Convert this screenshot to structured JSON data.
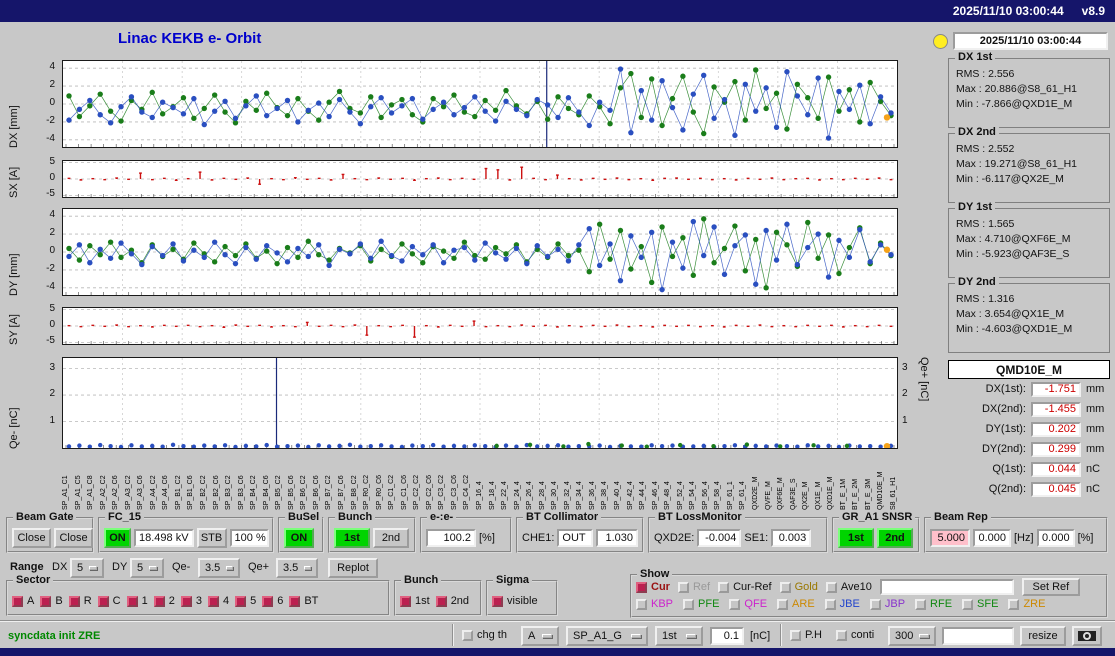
{
  "titlebar": {
    "datetime": "2025/11/10 03:00:44",
    "version": "v8.9"
  },
  "header": {
    "title": "Linac KEKB e- Orbit",
    "timestamp": "2025/11/10 03:00:44"
  },
  "colors": {
    "titlebar": "#15156a",
    "title_blue": "#0000cc",
    "button_green": "#00d400",
    "alert_pink": "#ffc0cb",
    "value_red": "#cc0000",
    "marker_amber": "#f5a31a",
    "series_blue": "#2a4fc0",
    "series_green": "#1a7d1a",
    "series_red": "#cc1111",
    "checkbox_red": "#bb2050",
    "status_green": "#008800"
  },
  "stats": [
    {
      "title": "DX 1st",
      "rms": "RMS : 2.556",
      "max": "Max : 20.886@S8_61_H1",
      "min": "Min : -7.866@QXD1E_M"
    },
    {
      "title": "DX 2nd",
      "rms": "RMS : 2.552",
      "max": "Max : 19.271@S8_61_H1",
      "min": "Min : -6.117@QX2E_M"
    },
    {
      "title": "DY 1st",
      "rms": "RMS : 1.565",
      "max": "Max : 4.710@QXF6E_M",
      "min": "Min : -5.923@QAF3E_S"
    },
    {
      "title": "DY 2nd",
      "rms": "RMS : 1.316",
      "max": "Max : 3.654@QX1E_M",
      "min": "Min : -4.603@QXD1E_M"
    }
  ],
  "monitor": {
    "title": "QMD10E_M",
    "rows": [
      {
        "label": "DX(1st):",
        "value": "-1.751",
        "unit": "mm"
      },
      {
        "label": "DX(2nd):",
        "value": "-1.455",
        "unit": "mm"
      },
      {
        "label": "DY(1st):",
        "value": "0.202",
        "unit": "mm"
      },
      {
        "label": "DY(2nd):",
        "value": "0.299",
        "unit": "mm"
      },
      {
        "label": "Q(1st):",
        "value": "0.044",
        "unit": "nC"
      },
      {
        "label": "Q(2nd):",
        "value": "0.045",
        "unit": "nC"
      }
    ]
  },
  "controls": {
    "beam_gate": {
      "label": "Beam Gate",
      "btn1": "Close",
      "btn2": "Close"
    },
    "fc15": {
      "label": "FC_15",
      "on": "ON",
      "kv": "18.498 kV",
      "stb": "STB",
      "pct": "100 %"
    },
    "busel": {
      "label": "BuSel",
      "on": "ON"
    },
    "bunch": {
      "label": "Bunch",
      "b1": "1st",
      "b2": "2nd"
    },
    "ee": {
      "label": "e-:e-",
      "value": "100.2",
      "unit": "[%]"
    },
    "bt_collimator": {
      "label": "BT Collimator",
      "che1": "CHE1:",
      "out": "OUT",
      "val": "1.030"
    },
    "bt_lossmonitor": {
      "label": "BT LossMonitor",
      "qxd2e": "QXD2E:",
      "qxd2e_val": "-0.004",
      "se1": "SE1:",
      "se1_val": "0.003"
    },
    "gr_snsr": {
      "label": "GR_A1 SNSR",
      "b1": "1st",
      "b2": "2nd"
    },
    "beam_rep": {
      "label": "Beam Rep",
      "v1": "5.000",
      "v2": "0.000",
      "hz": "[Hz]",
      "v3": "0.000",
      "pct": "[%]"
    },
    "range": {
      "label": "Range",
      "dx_label": "DX",
      "dx": "5",
      "dy_label": "DY",
      "dy": "5",
      "qem_label": "Qe-",
      "qem": "3.5",
      "qep_label": "Qe+",
      "qep": "3.5",
      "replot": "Replot"
    },
    "sector": {
      "label": "Sector",
      "items": [
        "A",
        "B",
        "R",
        "C",
        "1",
        "2",
        "3",
        "4",
        "5",
        "6",
        "BT"
      ]
    },
    "bunch2": {
      "label": "Bunch",
      "items": [
        "1st",
        "2nd"
      ]
    },
    "sigma": {
      "label": "Sigma",
      "item": "visible"
    },
    "show": {
      "label": "Show",
      "row1": [
        "Cur",
        "Ref",
        "Cur-Ref",
        "Gold",
        "Ave10"
      ],
      "ref_input": "",
      "set_ref": "Set Ref",
      "row2": [
        "KBP",
        "PFE",
        "QFE",
        "ARE",
        "JBE",
        "JBP",
        "RFE",
        "SFE",
        "ZRE"
      ]
    },
    "statusbar": {
      "message": "syncdata init ZRE",
      "chg_th": "chg th",
      "combo_a": "A",
      "combo_sp": "SP_A1_G",
      "combo_1st": "1st",
      "th_val": "0.1",
      "nc": "[nC]",
      "ph": "P.H",
      "conti": "conti",
      "combo_300": "300",
      "input": "",
      "resize": "resize"
    }
  },
  "xaxis_labels": [
    "SP_A1_C1",
    "SP_A1_C5",
    "SP_A1_C8",
    "SP_A2_C2",
    "SP_A2_C6",
    "SP_A3_C2",
    "SP_A3_C6",
    "SP_A4_C2",
    "SP_A4_C6",
    "SP_B1_C2",
    "SP_B1_C6",
    "SP_B2_C2",
    "SP_B2_C6",
    "SP_B3_C2",
    "SP_B3_C6",
    "SP_B4_C2",
    "SP_B4_C6",
    "SP_B5_C2",
    "SP_B5_C6",
    "SP_B6_C2",
    "SP_B6_C6",
    "SP_B7_C2",
    "SP_B7_C6",
    "SP_B8_C2",
    "SP_R0_C2",
    "SP_R0_C6",
    "SP_C1_C2",
    "SP_C1_C6",
    "SP_C2_C2",
    "SP_C2_C6",
    "SP_C3_C2",
    "SP_C3_C6",
    "SP_C4_C2",
    "SP_16_4",
    "SP_18_4",
    "SP_22_4",
    "SP_24_4",
    "SP_26_4",
    "SP_28_4",
    "SP_30_4",
    "SP_32_4",
    "SP_34_4",
    "SP_36_4",
    "SP_38_4",
    "SP_40_4",
    "SP_42_4",
    "SP_44_4",
    "SP_46_4",
    "SP_48_4",
    "SP_52_4",
    "SP_54_4",
    "SP_56_4",
    "SP_58_4",
    "SP_61_1",
    "SP_61_4",
    "QXD2E_M",
    "QVFE_M",
    "QXF6E_M",
    "QAF3E_S",
    "QX2E_M",
    "QX1E_M",
    "QXD1E_M",
    "BT_E_1M",
    "BT_E_2M",
    "BT_E_3M",
    "QMD10E_M",
    "S8_61_H1"
  ],
  "chart_data": [
    {
      "id": "dx",
      "type": "scatter",
      "ylabel": "DX [mm]",
      "ylim": [
        -4.8,
        4.8
      ],
      "yticks": [
        4,
        2,
        0,
        -2,
        -4
      ],
      "vlines": [
        0.58
      ],
      "marker": {
        "x": 0.988,
        "y": -1.5,
        "color": "#f5a31a"
      },
      "series": [
        {
          "name": "dx-2nd",
          "color": "#1a7d1a",
          "values": [
            0.9,
            -1.4,
            -0.2,
            1.1,
            -0.8,
            -1.9,
            0.4,
            -0.6,
            1.3,
            -1.1,
            -0.3,
            0.7,
            -1.6,
            -0.5,
            1.0,
            -0.9,
            -2.1,
            0.3,
            -0.7,
            1.2,
            -0.4,
            -1.3,
            0.6,
            -0.8,
            -1.8,
            0.2,
            1.4,
            -0.5,
            -1.0,
            0.8,
            -1.5,
            -0.1,
            0.5,
            -1.2,
            -2.0,
            0.6,
            -0.3,
            1.0,
            -0.9,
            -1.4,
            0.4,
            -0.7,
            1.5,
            -0.2,
            -1.1,
            0.3,
            -1.7,
            0.8,
            -0.5,
            -1.2,
            0.9,
            -0.3,
            -2.2,
            1.8,
            3.4,
            -1.5,
            2.8,
            -2.4,
            0.6,
            3.1,
            -0.9,
            -3.3,
            1.9,
            0.2,
            2.5,
            -1.8,
            3.8,
            -0.5,
            1.2,
            -2.8,
            2.2,
            0.7,
            -1.6,
            3.0,
            -0.8,
            1.6,
            -2.0,
            2.4,
            0.3,
            -1.3
          ]
        },
        {
          "name": "dx-1st",
          "color": "#2a4fc0",
          "values": [
            -1.8,
            -0.6,
            0.4,
            -1.2,
            -2.1,
            -0.3,
            0.8,
            -0.9,
            -1.5,
            0.2,
            -0.4,
            -1.1,
            0.6,
            -2.3,
            -0.8,
            0.3,
            -1.6,
            -0.2,
            0.9,
            -1.3,
            -0.5,
            0.4,
            -2.0,
            -0.7,
            0.1,
            -1.4,
            0.5,
            -0.9,
            -2.2,
            -0.3,
            0.7,
            -1.0,
            -0.2,
            0.6,
            -1.7,
            -0.6,
            0.2,
            -1.2,
            -0.4,
            0.8,
            -0.8,
            -1.9,
            0.3,
            -0.6,
            -1.3,
            0.5,
            -0.1,
            -1.5,
            0.7,
            -0.9,
            -2.4,
            0.2,
            -0.7,
            3.9,
            -3.2,
            1.5,
            -1.8,
            2.6,
            -0.4,
            -2.9,
            1.1,
            3.2,
            -1.6,
            0.5,
            -3.5,
            2.2,
            -0.8,
            1.8,
            -2.6,
            3.6,
            0.9,
            -1.2,
            2.9,
            -3.8,
            1.4,
            -0.6,
            2.1,
            -2.2,
            0.8,
            -1.0
          ]
        }
      ]
    },
    {
      "id": "sx",
      "type": "bar",
      "ylabel": "SX [A]",
      "ylim": [
        -5.5,
        5.5
      ],
      "yticks": [
        5,
        0,
        -5
      ],
      "color": "#cc1111",
      "values": [
        0.2,
        -0.3,
        0.1,
        -0.2,
        0.3,
        -0.1,
        1.8,
        -0.2,
        0.2,
        -0.4,
        0.1,
        2.1,
        -0.3,
        0.2,
        -0.1,
        0.3,
        -1.6,
        0.1,
        -0.2,
        0.4,
        -0.1,
        0.2,
        -0.3,
        1.4,
        0.1,
        -0.2,
        0.3,
        -0.1,
        0.2,
        -0.4,
        0.1,
        0.3,
        -0.2,
        0.2,
        -0.1,
        3.2,
        2.8,
        -0.3,
        3.6,
        0.2,
        -0.2,
        1.2,
        0.1,
        -0.3,
        0.2,
        -0.1,
        0.3,
        -0.2,
        0.1,
        -0.4,
        0.2,
        0.3,
        -0.1,
        0.2,
        -0.2,
        0.1,
        -0.3,
        0.2,
        -0.1,
        0.3,
        -0.2,
        0.1,
        0.2,
        -0.3,
        0.1,
        -0.2,
        0.2,
        -0.1,
        0.3,
        -0.2
      ]
    },
    {
      "id": "dy",
      "type": "scatter",
      "ylabel": "DY [mm]",
      "ylim": [
        -4.8,
        4.8
      ],
      "yticks": [
        4,
        2,
        0,
        -2,
        -4
      ],
      "marker": {
        "x": 0.988,
        "y": 0.25,
        "color": "#f5a31a"
      },
      "series": [
        {
          "name": "dy-2nd",
          "color": "#1a7d1a",
          "values": [
            0.4,
            -0.9,
            0.7,
            -0.3,
            1.1,
            -0.6,
            0.2,
            -1.2,
            0.8,
            -0.5,
            0.3,
            -0.8,
            1.0,
            -0.2,
            -1.1,
            0.6,
            -0.4,
            0.9,
            -0.7,
            0.1,
            -1.3,
            0.5,
            -0.6,
            1.2,
            -0.3,
            -0.9,
            0.4,
            -0.1,
            0.7,
            -1.0,
            0.3,
            -0.5,
            0.9,
            -0.2,
            -1.2,
            0.6,
            0.1,
            -0.7,
            1.1,
            -0.4,
            -0.8,
            0.5,
            -0.2,
            0.8,
            -1.1,
            0.3,
            -0.6,
            0.9,
            -0.4,
            0.2,
            -2.2,
            3.1,
            -0.8,
            2.4,
            -1.9,
            0.6,
            -3.4,
            2.8,
            -0.5,
            1.6,
            -2.6,
            3.7,
            -1.2,
            0.4,
            2.9,
            -2.1,
            1.4,
            -4.0,
            2.2,
            0.8,
            -1.6,
            3.3,
            -0.7,
            1.9,
            -2.4,
            0.5,
            2.7,
            -1.3,
            1.0,
            -0.4
          ]
        },
        {
          "name": "dy-1st",
          "color": "#2a4fc0",
          "values": [
            -0.5,
            0.8,
            -1.2,
            0.3,
            -0.7,
            1.0,
            -0.2,
            -1.4,
            0.6,
            -0.4,
            0.9,
            -1.0,
            0.2,
            -0.6,
            1.1,
            -0.3,
            -1.3,
            0.5,
            -0.8,
            0.7,
            -0.1,
            -1.1,
            0.4,
            -0.5,
            0.8,
            -1.5,
            0.3,
            -0.2,
            0.9,
            -0.7,
            1.2,
            -0.4,
            -1.0,
            0.6,
            -0.3,
            0.8,
            -1.2,
            0.2,
            0.5,
            -0.9,
            1.0,
            -0.1,
            -0.8,
            0.4,
            -1.3,
            0.7,
            -0.5,
            0.3,
            -1.0,
            0.8,
            2.6,
            -1.5,
            0.9,
            -3.2,
            1.8,
            -0.6,
            2.2,
            -4.2,
            1.1,
            -1.8,
            3.4,
            -0.4,
            2.8,
            -2.5,
            0.7,
            1.9,
            -3.6,
            2.4,
            -0.9,
            3.1,
            -1.4,
            0.5,
            2.0,
            -2.8,
            1.3,
            -0.6,
            2.5,
            -1.1,
            0.8,
            -0.3
          ]
        }
      ]
    },
    {
      "id": "sy",
      "type": "bar",
      "ylabel": "SY [A]",
      "ylim": [
        -5.5,
        5.5
      ],
      "yticks": [
        5,
        0,
        -5
      ],
      "color": "#cc1111",
      "values": [
        0.1,
        -0.2,
        0.2,
        -0.1,
        0.3,
        -0.2,
        0.1,
        -0.3,
        0.2,
        -0.1,
        0.2,
        -0.2,
        0.1,
        -0.4,
        0.3,
        -0.1,
        0.2,
        -0.3,
        0.1,
        -0.2,
        1.1,
        -0.1,
        0.2,
        -0.2,
        0.3,
        -2.8,
        0.1,
        -0.2,
        0.2,
        -3.4,
        0.1,
        -0.3,
        0.2,
        -0.1,
        1.5,
        -0.2,
        0.1,
        -0.2,
        0.3,
        -0.1,
        0.2,
        -0.3,
        0.1,
        -0.2,
        0.2,
        -0.1,
        0.3,
        -0.2,
        0.1,
        -0.3,
        0.2,
        -0.1,
        0.2,
        -0.2,
        0.1,
        -0.3,
        0.2,
        -0.1,
        0.3,
        -0.2,
        0.1,
        -0.2,
        0.2,
        -0.1,
        0.2,
        -0.3,
        0.1,
        -0.2,
        0.2,
        -0.1
      ]
    },
    {
      "id": "q",
      "type": "scatter",
      "ylabel": "Qe- [nC]",
      "ylabel_right": "Qe+ [nC]",
      "ylim": [
        0,
        3.4
      ],
      "yticks": [
        3,
        2,
        1
      ],
      "yticks_right": [
        3,
        2,
        1
      ],
      "vlines": [
        0.256
      ],
      "marker": {
        "x": 0.988,
        "y": 0.07,
        "color": "#f5a31a"
      },
      "series": [
        {
          "name": "q-e-",
          "color": "#2a4fc0",
          "r": 2.2,
          "noline": true,
          "values": [
            0.06,
            0.09,
            0.05,
            0.11,
            0.07,
            0.04,
            0.1,
            0.06,
            0.08,
            0.05,
            0.12,
            0.07,
            0.05,
            0.09,
            0.06,
            0.1,
            0.04,
            0.08,
            0.06,
            0.11,
            0.05,
            0.07,
            0.09,
            0.04,
            0.1,
            0.06,
            0.08,
            0.12,
            0.05,
            0.07,
            0.1,
            0.06,
            0.04,
            0.09,
            0.07,
            0.11,
            0.05,
            0.08,
            0.06,
            0.1,
            0.07,
            0.04,
            0.09,
            0.05,
            0.11,
            0.06,
            0.08,
            0.1,
            0.05,
            0.07,
            0.06,
            0.09,
            0.04,
            0.08,
            0.06,
            0.05,
            0.1,
            0.07,
            0.09,
            0.05,
            0.06,
            0.08,
            0.04,
            0.07,
            0.1,
            0.05,
            0.08,
            0.06,
            0.09,
            0.07,
            0.05,
            0.1,
            0.06,
            0.08,
            0.04,
            0.09,
            0.06,
            0.07,
            0.05,
            0.08
          ]
        },
        {
          "name": "q-e+",
          "color": "#1a7d1a",
          "r": 2.2,
          "noline": true,
          "x": [
            0.52,
            0.56,
            0.6,
            0.63,
            0.67,
            0.7,
            0.74,
            0.78,
            0.82,
            0.86,
            0.9,
            0.94
          ],
          "values": [
            0.08,
            0.12,
            0.06,
            0.15,
            0.09,
            0.05,
            0.11,
            0.07,
            0.13,
            0.06,
            0.1,
            0.08
          ]
        }
      ]
    }
  ]
}
